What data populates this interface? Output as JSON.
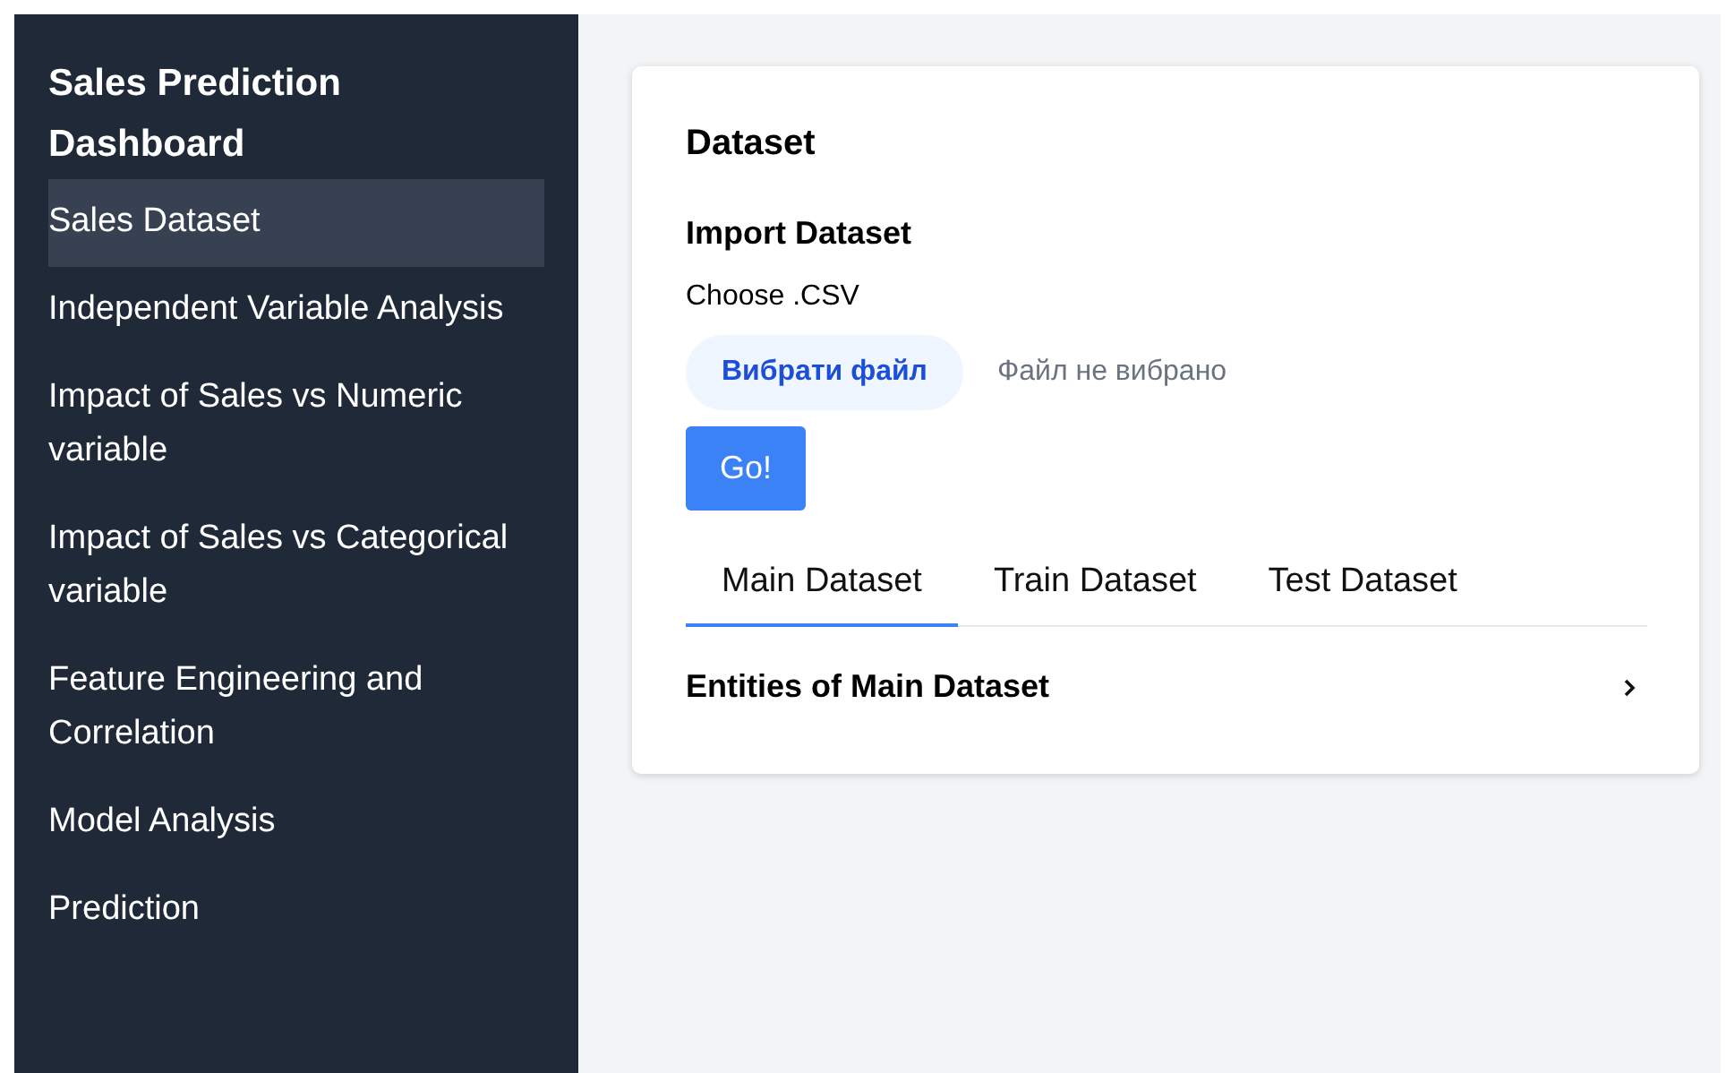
{
  "sidebar": {
    "title": "Sales Prediction Dashboard",
    "items": [
      {
        "label": "Sales Dataset",
        "selected": true
      },
      {
        "label": "Independent Variable Analysis",
        "selected": false
      },
      {
        "label": "Impact of Sales vs Numeric variable",
        "selected": false
      },
      {
        "label": "Impact of Sales vs Categorical variable",
        "selected": false
      },
      {
        "label": "Feature Engineering and Correlation",
        "selected": false
      },
      {
        "label": "Model Analysis",
        "selected": false
      },
      {
        "label": "Prediction",
        "selected": false
      }
    ]
  },
  "card": {
    "title": "Dataset",
    "import": {
      "heading": "Import Dataset",
      "label": "Choose .CSV",
      "file_button": "Вибрати файл",
      "file_status": "Файл не вибрано",
      "submit": "Go!"
    },
    "tabs": [
      {
        "label": "Main Dataset",
        "selected": true
      },
      {
        "label": "Train Dataset",
        "selected": false
      },
      {
        "label": "Test Dataset",
        "selected": false
      }
    ],
    "expander": {
      "label": "Entities of Main Dataset",
      "expanded": false
    }
  }
}
